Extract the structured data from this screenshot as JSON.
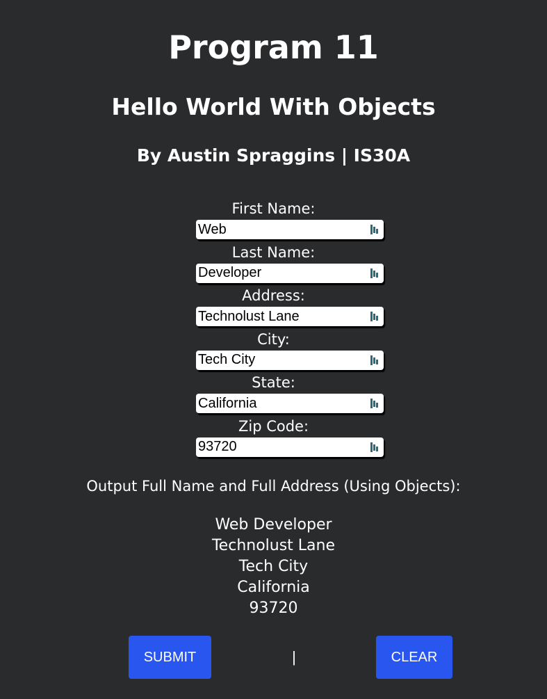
{
  "header": {
    "title": "Program 11",
    "subtitle": "Hello World With Objects",
    "byline": "By Austin Spraggins | IS30A"
  },
  "form": {
    "fields": [
      {
        "label": "First Name:",
        "value": "Web",
        "icon": "password-manager-icon"
      },
      {
        "label": "Last Name:",
        "value": "Developer",
        "icon": "password-manager-icon"
      },
      {
        "label": "Address:",
        "value": "Technolust Lane",
        "icon": "password-manager-icon"
      },
      {
        "label": "City:",
        "value": "Tech City",
        "icon": "password-manager-icon"
      },
      {
        "label": "State:",
        "value": "California",
        "icon": "password-manager-icon"
      },
      {
        "label": "Zip Code:",
        "value": "93720",
        "icon": "password-manager-icon"
      }
    ]
  },
  "output": {
    "label": "Output Full Name and Full Address (Using Objects):",
    "lines": [
      "Web Developer",
      "Technolust Lane",
      "Tech City",
      "California",
      "93720"
    ]
  },
  "actions": {
    "submit_label": "SUBMIT",
    "separator": "|",
    "clear_label": "CLEAR"
  },
  "colors": {
    "background": "#2a2b2d",
    "button": "#2a56f0",
    "text": "#ffffff",
    "icon": "#2a6b7a"
  }
}
